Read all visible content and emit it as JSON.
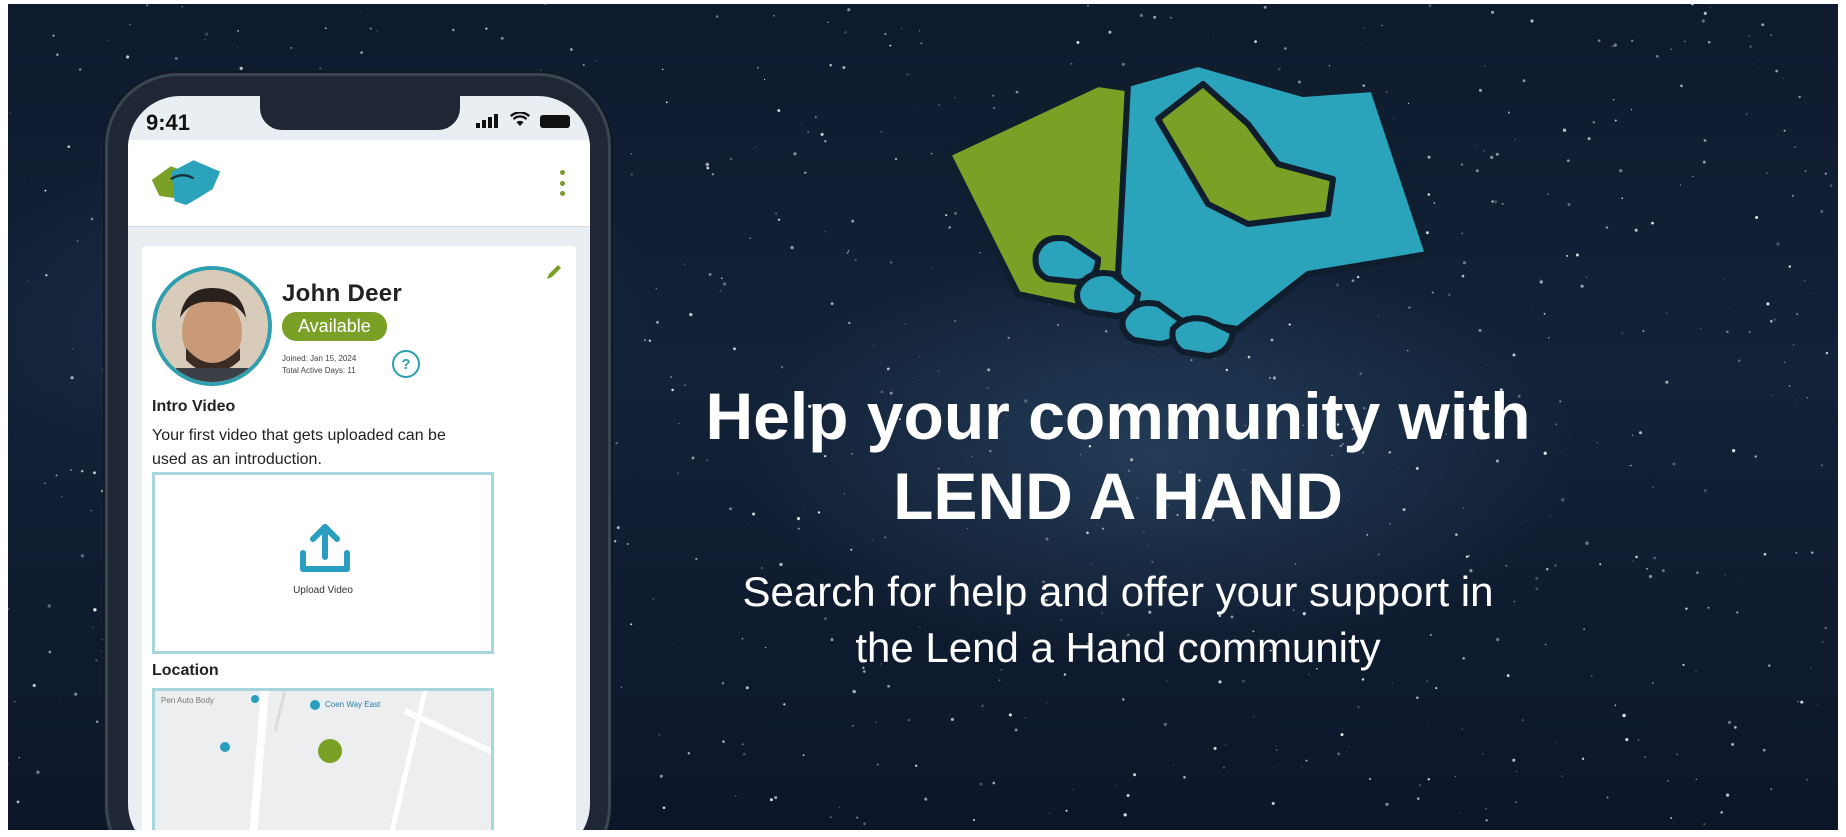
{
  "colors": {
    "background": "#122238",
    "hand_green": "#7aa126",
    "hand_blue": "#2aa3bb",
    "accent_teal": "#2f9fb0",
    "badge_green": "#7aa126",
    "text_white": "#ffffff"
  },
  "hero": {
    "logo_icon": "handshake-icon",
    "headline_line1": "Help your community with",
    "headline_line2": "LEND A HAND",
    "subhead_line1": "Search for help and offer your support in",
    "subhead_line2": "the Lend a Hand community"
  },
  "phone": {
    "status": {
      "time": "9:41",
      "icons": [
        "signal-icon",
        "wifi-icon",
        "battery-icon"
      ]
    },
    "header": {
      "logo_icon": "handshake-icon",
      "menu_icon": "kebab-menu-icon"
    },
    "profile": {
      "name": "John Deer",
      "status_badge": "Available",
      "joined": "Joined: Jan 15, 2024",
      "total_active_days": "Total Active Days: 11",
      "help_icon": "question-icon",
      "edit_icon": "pencil-icon"
    },
    "intro": {
      "title": "Intro Video",
      "description": "Your first video that gets uploaded can be used as an introduction.",
      "upload_label": "Upload Video",
      "upload_icon": "upload-icon"
    },
    "location": {
      "title": "Location",
      "map_labels": [
        "Pen Auto Body",
        "Coen Way East"
      ]
    }
  }
}
